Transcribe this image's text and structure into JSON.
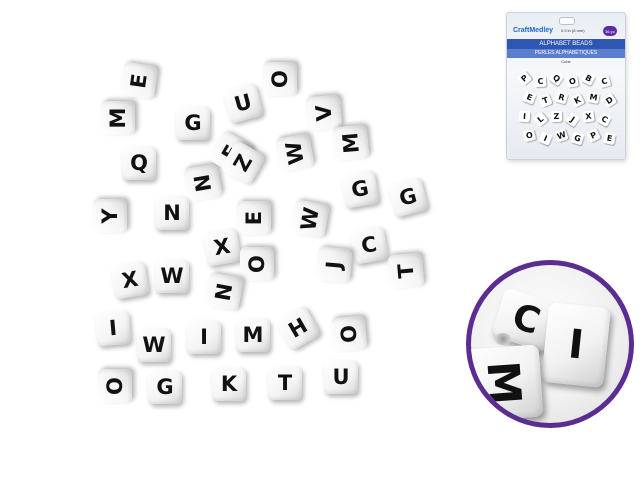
{
  "package": {
    "brand": "CraftMedley",
    "size_text": "0.3 in (8 mm)",
    "count_badge": "36 pc",
    "title": "ALPHABET BEADS",
    "title_fr": "PERLES ALPHABÉTIQUES",
    "bead_type": "Cube",
    "window_letters": [
      "P",
      "C",
      "Q",
      "O",
      "B",
      "C",
      "E",
      "T",
      "R",
      "K",
      "M",
      "D",
      "I",
      "L",
      "Z",
      "J",
      "X",
      "C",
      "O",
      "I",
      "W",
      "G",
      "P",
      "E"
    ]
  },
  "beads": [
    "E",
    "O",
    "M",
    "G",
    "U",
    "V",
    "W",
    "M",
    "Q",
    "N",
    "E",
    "Z",
    "G",
    "G",
    "Y",
    "N",
    "E",
    "X",
    "W",
    "C",
    "J",
    "T",
    "X",
    "W",
    "O",
    "N",
    "I",
    "W",
    "I",
    "M",
    "H",
    "O",
    "O",
    "G",
    "K",
    "T",
    "U"
  ],
  "zoom": {
    "letters": [
      "C",
      "I",
      "M"
    ],
    "border_color": "#5c2d91"
  },
  "colors": {
    "accent": "#2f56b3",
    "brand": "#1e66c8",
    "badge": "#5a2ca8"
  }
}
